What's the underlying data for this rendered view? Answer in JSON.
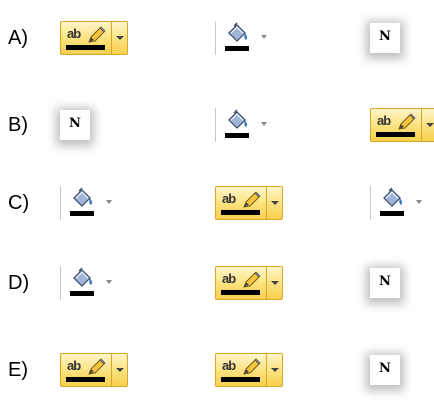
{
  "options": [
    {
      "label": "A)",
      "items": [
        "highlight",
        "fill",
        "n"
      ]
    },
    {
      "label": "B)",
      "items": [
        "n",
        "fill",
        "highlight"
      ]
    },
    {
      "label": "C)",
      "items": [
        "fill",
        "highlight",
        "fill"
      ]
    },
    {
      "label": "D)",
      "items": [
        "fill",
        "highlight",
        "n"
      ]
    },
    {
      "label": "E)",
      "items": [
        "highlight",
        "highlight",
        "n"
      ]
    }
  ],
  "icons": {
    "highlight_text": "ab",
    "n_text": "N"
  }
}
